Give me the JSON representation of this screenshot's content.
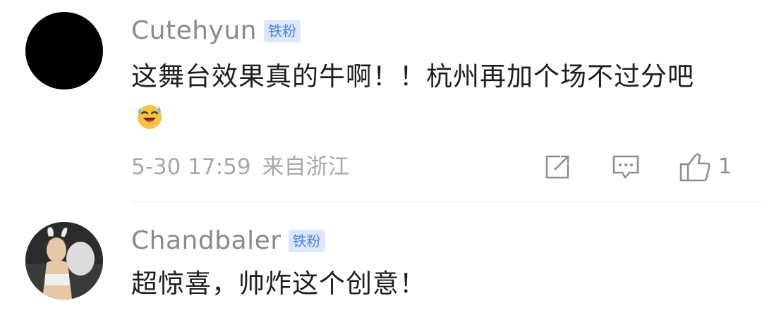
{
  "comments": [
    {
      "username": "Cutehyun",
      "badge": "铁粉",
      "text": "这舞台效果真的牛啊！！杭州再加个场不过分吧",
      "emoji": "laughing-crying-emoji",
      "date": "5-30 17:59",
      "location": "来自浙江",
      "like_count": "1"
    },
    {
      "username": "Chandbaler",
      "badge": "铁粉",
      "text": "超惊喜，帅炸这个创意！"
    }
  ],
  "colors": {
    "username": "#8a8a8a",
    "text": "#1f1f1f",
    "meta": "#a8a8a8",
    "badge_bg": "#dbe8fb",
    "badge_text": "#4c84e0",
    "icon": "#8f8f8f"
  },
  "icons": [
    "share-icon",
    "reply-icon",
    "thumbs-up-icon"
  ]
}
